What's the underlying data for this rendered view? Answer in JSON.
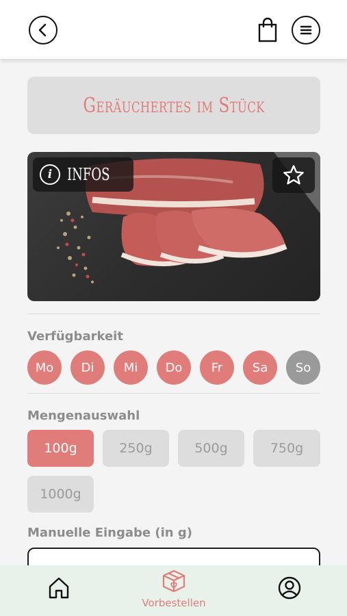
{
  "header": {
    "back_icon": "chevron-left-icon",
    "cart_icon": "shopping-bag-icon",
    "menu_icon": "menu-icon"
  },
  "product": {
    "title": "Geräuchertes im Stück",
    "info_label": "INFOS",
    "favorite_icon": "star-icon"
  },
  "availability": {
    "label": "Verfügbarkeit",
    "days": [
      {
        "label": "Mo",
        "available": true
      },
      {
        "label": "Di",
        "available": true
      },
      {
        "label": "Mi",
        "available": true
      },
      {
        "label": "Do",
        "available": true
      },
      {
        "label": "Fr",
        "available": true
      },
      {
        "label": "Sa",
        "available": true
      },
      {
        "label": "So",
        "available": false
      }
    ]
  },
  "quantity": {
    "label": "Mengenauswahl",
    "options": [
      "100g",
      "250g",
      "500g",
      "750g",
      "1000g"
    ],
    "selected": "100g"
  },
  "manual": {
    "label": "Manuelle Eingabe (in g)",
    "value": ""
  },
  "bottom_nav": {
    "home_icon": "home-icon",
    "order_label": "Vorbestellen",
    "order_icon": "box-icon",
    "profile_icon": "user-icon"
  },
  "colors": {
    "accent": "#e07d7b",
    "inactive": "#9a9a9a",
    "nav_bg": "#e8f2ea"
  }
}
